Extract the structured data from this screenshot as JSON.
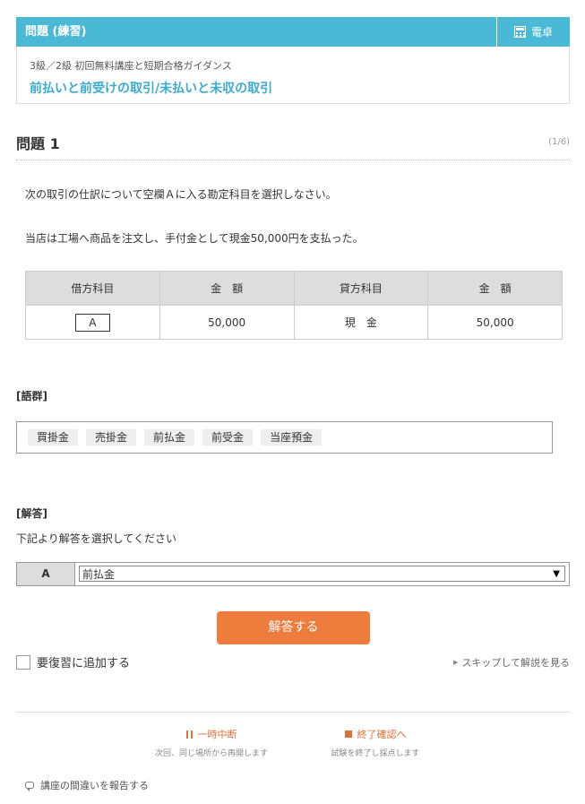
{
  "header": {
    "title": "問題 (練習)",
    "calculator_label": "電卓"
  },
  "course": {
    "subtitle": "3級／2級 初回無料講座と短期合格ガイダンス",
    "title": "前払いと前受けの取引/未払いと未収の取引"
  },
  "question": {
    "heading": "問題 1",
    "count": "(1/6)",
    "instruction": "次の取引の仕訳について空欄Ａに入る勘定科目を選択しなさい。",
    "scenario": "当店は工場へ商品を注文し、手付金として現金50,000円を支払った。"
  },
  "journal": {
    "headers": [
      "借方科目",
      "金　額",
      "貸方科目",
      "金　額"
    ],
    "row": {
      "debit_account": "A",
      "debit_amount": "50,000",
      "credit_account": "現　金",
      "credit_amount": "50,000"
    }
  },
  "word_group": {
    "label": "[語群]",
    "words": [
      "買掛金",
      "売掛金",
      "前払金",
      "前受金",
      "当座預金"
    ]
  },
  "answer": {
    "label": "[解答]",
    "instruction": "下記より解答を選択してください",
    "blank_label": "A",
    "selected": "前払金",
    "submit_label": "解答する"
  },
  "review": {
    "label": "要復習に追加する",
    "checked": false
  },
  "skip_label": "スキップして解説を見る",
  "footer": {
    "pause_label": "一時中断",
    "pause_sub": "次回、同じ場所から再開します",
    "finish_label": "終了確認へ",
    "finish_sub": "試験を終了し採点します"
  },
  "report_label": "講座の間違いを報告する",
  "colors": {
    "header_bg": "#4ab9d6",
    "title_accent": "#3aaccf",
    "button_orange": "#ee7c3c",
    "footer_orange": "#e0703a"
  },
  "icons": {
    "calculator": "calculator-icon",
    "pause": "pause-icon",
    "stop": "stop-icon",
    "report": "speech-bubble-icon",
    "skip": "triangle-right-icon",
    "select_arrow": "triangle-down-icon"
  }
}
